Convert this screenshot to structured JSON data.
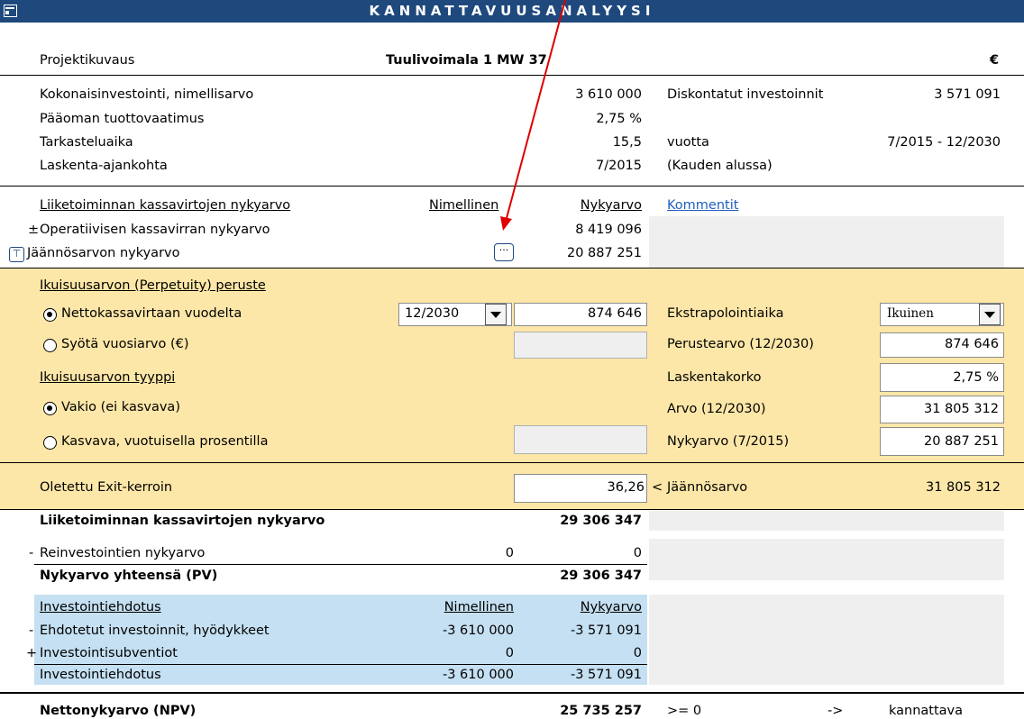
{
  "title": "KANNATTAVUUSANALYYSI",
  "colors": {
    "title_bar": "#1f497d",
    "title_text": "#ffffff",
    "perpetuity_bg": "#fde7a8",
    "investment_bg": "#c5e0f2",
    "comment_bg": "#efefef",
    "arrow": "#e00000",
    "link": "#1f5fbf"
  },
  "project": {
    "label": "Projektikuvaus",
    "name": "Tuulivoimala 1 MW 37",
    "currency": "€"
  },
  "params": {
    "total_investment_label": "Kokonaisinvestointi, nimellisarvo",
    "total_investment": "3 610 000",
    "discounted_investments_label": "Diskontatut investoinnit",
    "discounted_investments": "3 571 091",
    "return_req_label": "Pääoman tuottovaatimus",
    "return_req": "2,75 %",
    "period_label": "Tarkasteluaika",
    "period": "15,5",
    "period_unit": "vuotta",
    "period_range": "7/2015 - 12/2030",
    "calc_time_label": "Laskenta-ajankohta",
    "calc_time": "7/2015",
    "calc_time_note": "(Kauden alussa)"
  },
  "cashflow": {
    "heading": "Liiketoiminnan kassavirtojen nykyarvo",
    "col_nominal": "Nimellinen",
    "col_pv": "Nykyarvo",
    "comments_link": "Kommentit",
    "op_sign": "±",
    "op_label": "Operatiivisen kassavirran nykyarvo",
    "op_pv": "8 419 096",
    "res_label": "Jäännösarvon nykyarvo",
    "res_pv": "20 887 251",
    "res_button": "···"
  },
  "perpetuity": {
    "basis_heading": "Ikuisuusarvon (Perpetuity) peruste",
    "opt1_label": "Nettokassavirtaan vuodelta",
    "opt1_year": "12/2030",
    "opt1_value": "874 646",
    "opt2_label": "Syötä vuosiarvo (€)",
    "type_heading": "Ikuisuusarvon tyyppi",
    "type1_label": "Vakio (ei kasvava)",
    "type2_label": "Kasvava, vuotuisella prosentilla",
    "extrap_label": "Ekstrapolointiaika",
    "extrap_value": "Ikuinen",
    "base_label": "Perustearvo (12/2030)",
    "base_value": "874 646",
    "rate_label": "Laskentakorko",
    "rate_value": "2,75 %",
    "value_label": "Arvo (12/2030)",
    "value_value": "31 805 312",
    "pv_label": "Nykyarvo (7/2015)",
    "pv_value": "20 887 251",
    "exit_label": "Oletettu Exit-kerroin",
    "exit_value": "36,26",
    "exit_arrow": "<",
    "residual_label": "Jäännösarvo",
    "residual_value": "31 805 312"
  },
  "summary": {
    "cf_pv_label": "Liiketoiminnan kassavirtojen nykyarvo",
    "cf_pv": "29 306 347",
    "reinv_sign": "-",
    "reinv_label": "Reinvestointien nykyarvo",
    "reinv_nominal": "0",
    "reinv_pv": "0",
    "total_label": "Nykyarvo yhteensä (PV)",
    "total_pv": "29 306 347"
  },
  "investment": {
    "heading": "Investointiehdotus",
    "col_nominal": "Nimellinen",
    "col_pv": "Nykyarvo",
    "row1_sign": "-",
    "row1_label": "Ehdotetut investoinnit, hyödykkeet",
    "row1_nominal": "-3 610 000",
    "row1_pv": "-3 571 091",
    "row2_sign": "+",
    "row2_label": "Investointisubventiot",
    "row2_nominal": "0",
    "row2_pv": "0",
    "total_label": "Investointiehdotus",
    "total_nominal": "-3 610 000",
    "total_pv": "-3 571 091"
  },
  "npv": {
    "label": "Nettonykyarvo (NPV)",
    "value": "25 735 257",
    "condition": ">= 0",
    "arrow": "->",
    "result": "kannattava"
  }
}
